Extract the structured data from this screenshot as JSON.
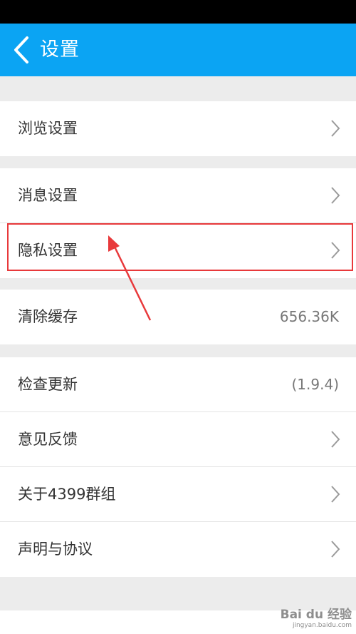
{
  "header": {
    "title": "设置"
  },
  "groups": [
    {
      "items": [
        {
          "label": "浏览设置"
        }
      ]
    },
    {
      "items": [
        {
          "label": "消息设置"
        },
        {
          "label": "隐私设置"
        }
      ]
    },
    {
      "items": [
        {
          "label": "清除缓存",
          "value": "656.36K"
        }
      ]
    },
    {
      "items": [
        {
          "label": "检查更新",
          "value": "(1.9.4)"
        },
        {
          "label": "意见反馈"
        },
        {
          "label": "关于4399群组"
        },
        {
          "label": "声明与协议"
        }
      ]
    }
  ],
  "watermark": {
    "text": "Bai du 经验",
    "url": "jingyan.baidu.com"
  },
  "colors": {
    "header": "#0ba4f3",
    "highlight": "#e8393b",
    "background": "#ececec"
  }
}
